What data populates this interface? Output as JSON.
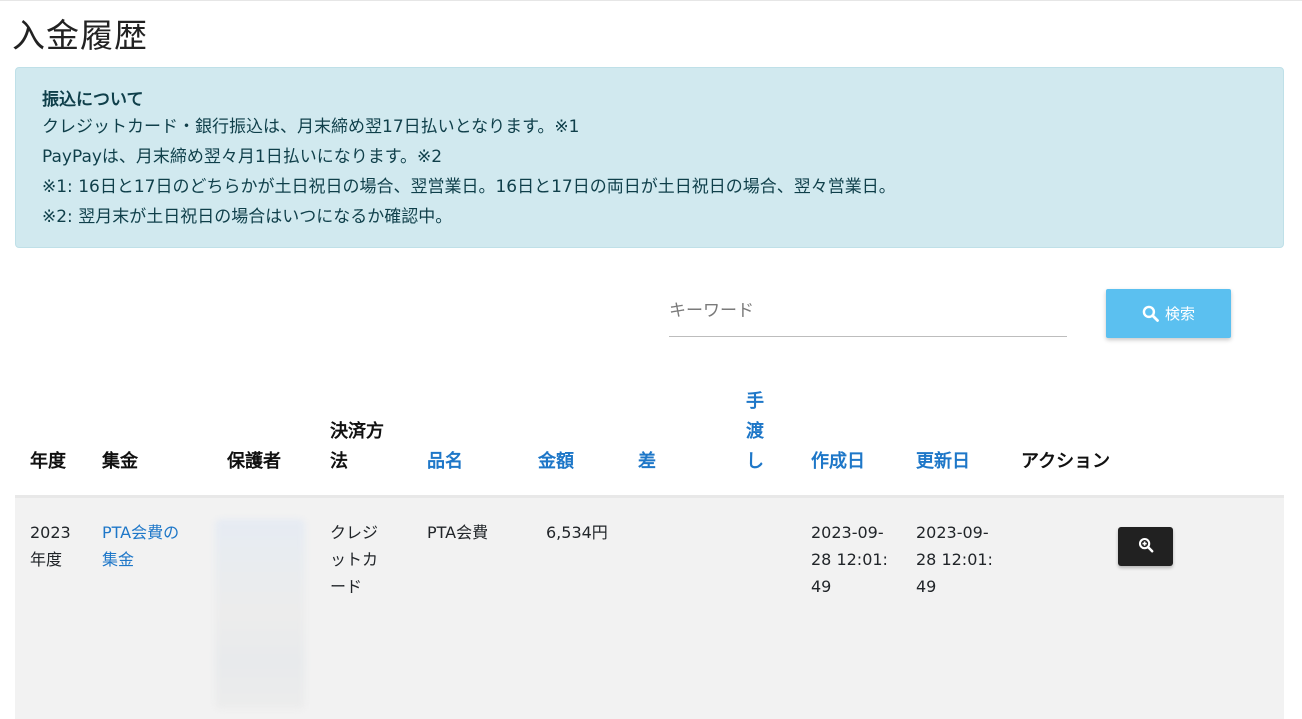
{
  "page": {
    "title": "入金履歴"
  },
  "alert": {
    "title": "振込について",
    "lines": [
      "クレジットカード・銀行振込は、月末締め翌17日払いとなります。※1",
      "PayPayは、月末締め翌々月1日払いになります。※2",
      "※1: 16日と17日のどちらかが土日祝日の場合、翌営業日。16日と17日の両日が土日祝日の場合、翌々営業日。",
      "※2: 翌月末が土日祝日の場合はいつになるか確認中。"
    ]
  },
  "search": {
    "placeholder": "キーワード",
    "value": "",
    "button_label": "検索",
    "button_icon": "search-icon"
  },
  "table": {
    "headers": {
      "year": {
        "label": "年度",
        "sortable": false
      },
      "collection": {
        "label": "集金",
        "sortable": false
      },
      "guardian": {
        "label": "保護者",
        "sortable": false
      },
      "payment_method": {
        "label_lines": [
          "決済方",
          "法"
        ],
        "sortable": false
      },
      "item_name": {
        "label": "品名",
        "sortable": true
      },
      "amount": {
        "label": "金額",
        "sortable": true
      },
      "difference": {
        "label": "差",
        "sortable": true
      },
      "handover": {
        "label_lines": [
          "手",
          "渡",
          "し"
        ],
        "sortable": true
      },
      "created": {
        "label": "作成日",
        "sortable": true
      },
      "updated": {
        "label": "更新日",
        "sortable": true
      },
      "action": {
        "label": "アクション",
        "sortable": false
      }
    },
    "rows": [
      {
        "year_lines": [
          "2023",
          "年度"
        ],
        "collection_lines": [
          "PTA会費の",
          "集金"
        ],
        "guardian": "",
        "payment_method_lines": [
          "クレジ",
          "ットカ",
          "ード"
        ],
        "item_name": "PTA会費",
        "amount": "6,534円",
        "difference": "",
        "handover": "",
        "created_lines": [
          "2023-09-",
          "28 12:01:",
          "49"
        ],
        "updated_lines": [
          "2023-09-",
          "28 12:01:",
          "49"
        ],
        "action_icon": "zoom-in-icon"
      }
    ]
  },
  "colors": {
    "alert_bg": "#d1e9ef",
    "alert_text": "#0f3f4a",
    "link": "#1e77c8",
    "search_button": "#5bc0f0",
    "view_button": "#212121",
    "row_bg": "#f2f2f2"
  }
}
